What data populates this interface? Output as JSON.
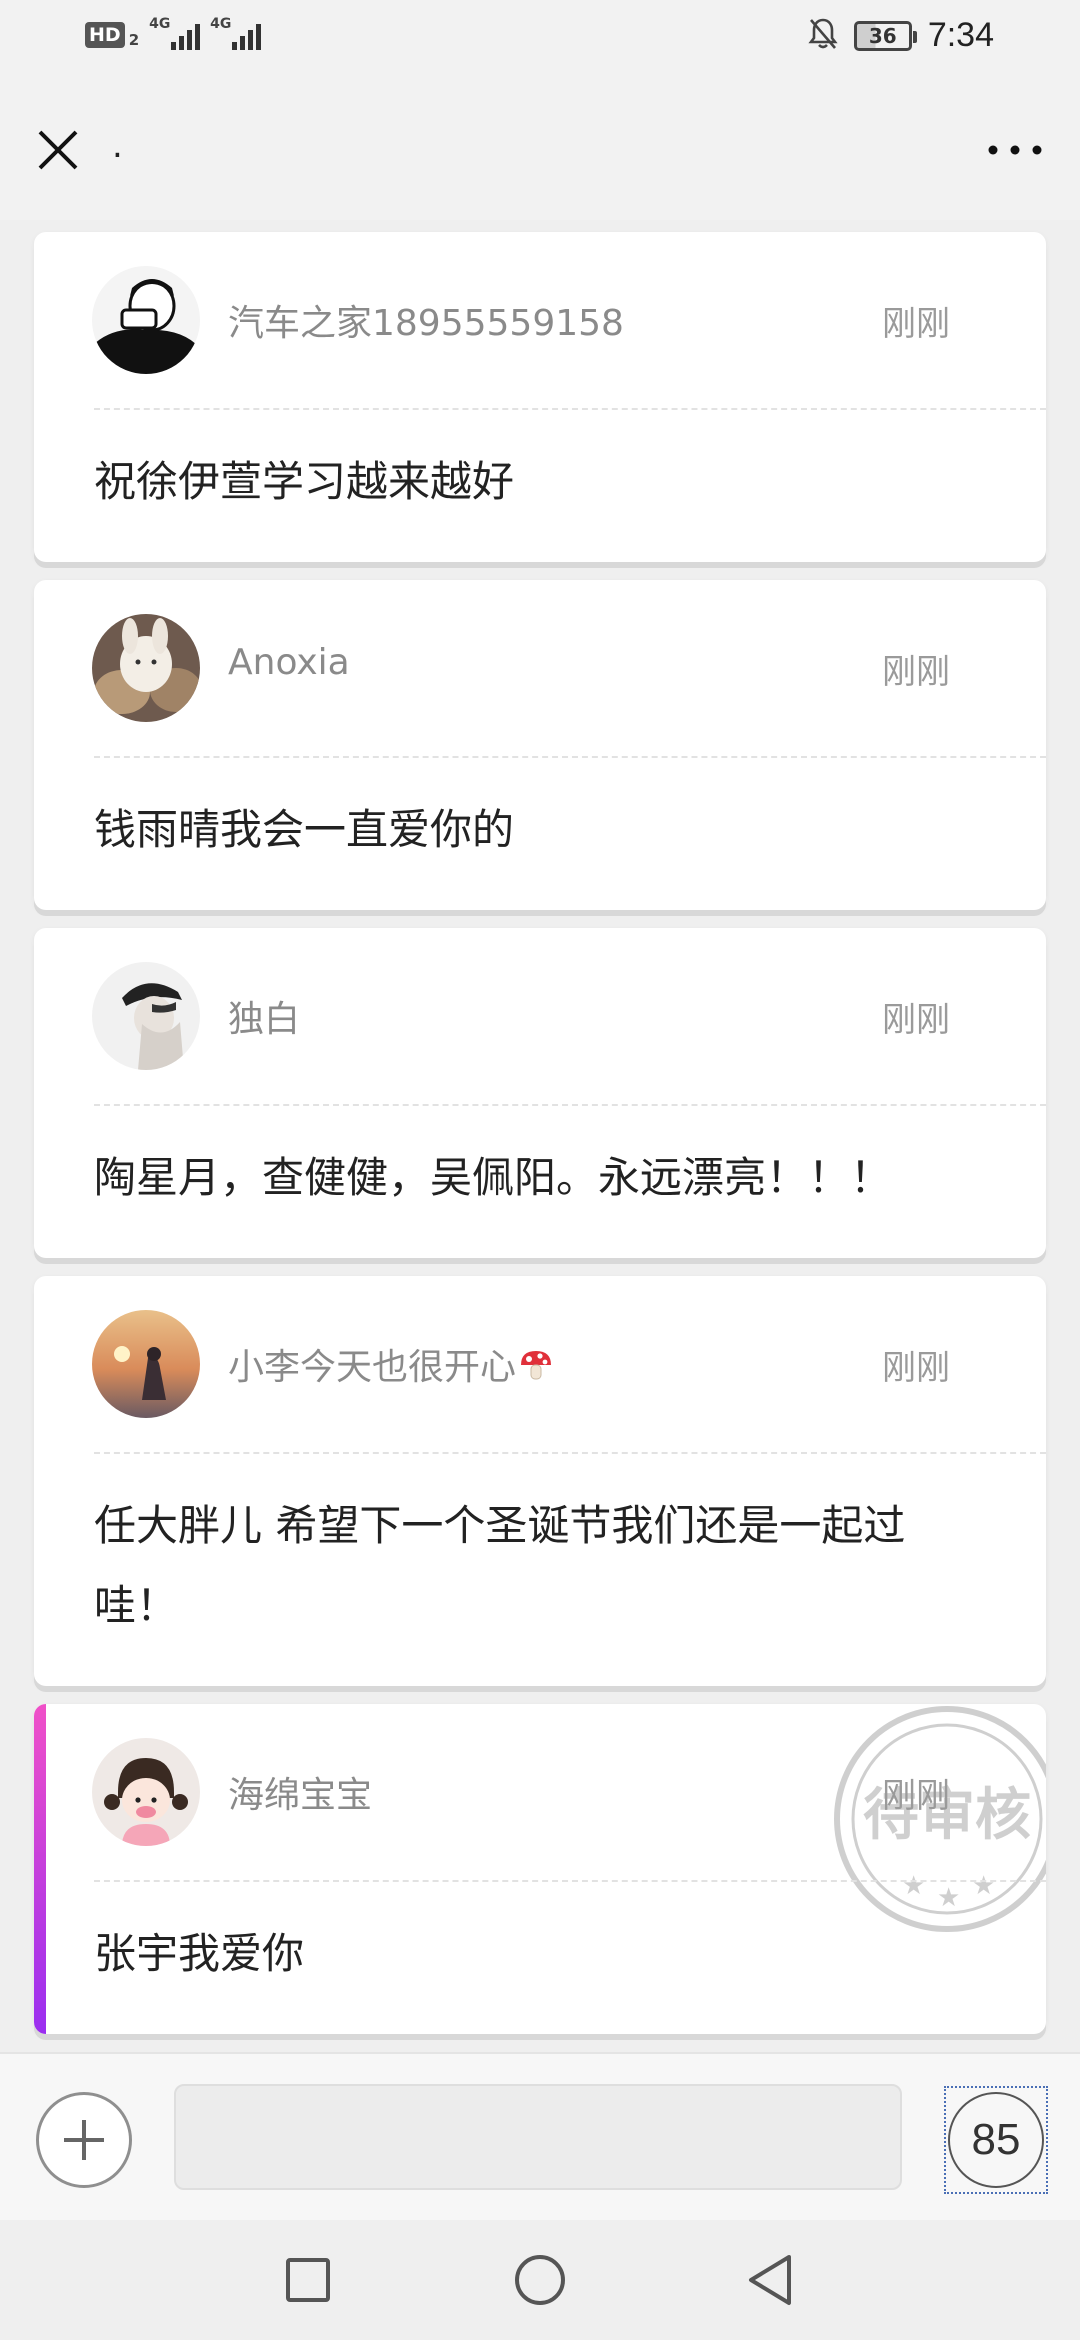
{
  "status_bar": {
    "hd": "HD",
    "hd_sub": "2",
    "net1": "4G",
    "net2": "4G",
    "battery": "36",
    "time": "7:34"
  },
  "title_bar": {
    "title": "."
  },
  "messages": [
    {
      "name": "汽车之家18955559158",
      "time": "刚刚",
      "text": "祝徐伊萱学习越来越好",
      "pending": false
    },
    {
      "name": "Anoxia",
      "time": "刚刚",
      "text": "钱雨晴我会一直爱你的",
      "pending": false
    },
    {
      "name": "独白",
      "time": "刚刚",
      "text": "陶星月，查健健，吴佩阳。永远漂亮！！！",
      "pending": false
    },
    {
      "name": "小李今天也很开心",
      "time": "刚刚",
      "text": "任大胖儿 希望下一个圣诞节我们还是一起过哇！",
      "pending": false
    },
    {
      "name": "海绵宝宝",
      "time": "刚刚",
      "text": "张宇我爱你",
      "pending": true,
      "stamp": "待审核"
    }
  ],
  "input_bar": {
    "count": "85",
    "input_value": ""
  },
  "colors": {
    "pending_accent_top": "#f050c8",
    "pending_accent_bottom": "#9a2ef0",
    "name_gray": "#8a8a8a"
  },
  "icons": {
    "close": "close-icon",
    "more": "more-icon",
    "plus": "plus-icon",
    "recents": "square-icon",
    "home": "circle-icon",
    "back": "triangle-back-icon",
    "mute": "bell-muted-icon"
  }
}
